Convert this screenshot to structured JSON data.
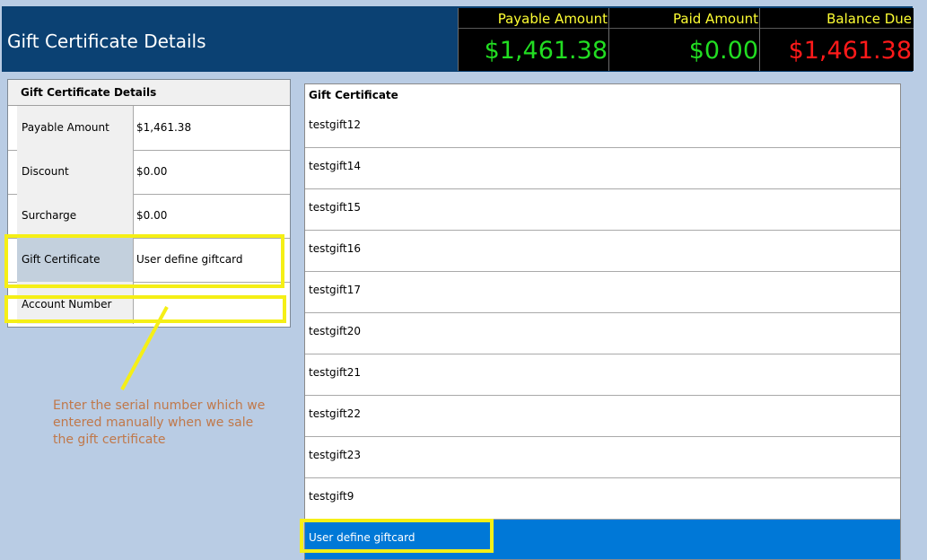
{
  "header": {
    "title": "Gift Certificate Details",
    "payable": {
      "label": "Payable Amount",
      "value": "$1,461.38",
      "color": "#22dd22"
    },
    "paid": {
      "label": "Paid Amount",
      "value": "$0.00",
      "color": "#22dd22"
    },
    "balance": {
      "label": "Balance Due",
      "value": "$1,461.38",
      "color": "#ff1a1a"
    }
  },
  "details": {
    "title": "Gift Certificate Details",
    "rows": [
      {
        "label": "Payable Amount",
        "value": "$1,461.38"
      },
      {
        "label": "Discount",
        "value": "$0.00"
      },
      {
        "label": "Surcharge",
        "value": "$0.00"
      },
      {
        "label": "Gift Certificate",
        "value": "User define giftcard"
      },
      {
        "label": "Account Number",
        "value": ""
      }
    ]
  },
  "list": {
    "header": "Gift Certificate",
    "items": [
      "testgift12",
      "testgift14",
      "testgift15",
      "testgift16",
      "testgift17",
      "testgift20",
      "testgift21",
      "testgift22",
      "testgift23",
      "testgift9",
      "User define giftcard"
    ],
    "selected_index": 10
  },
  "annotation": {
    "text": "Enter the serial number which we entered manually when we sale the gift certificate",
    "color": "#c0784a",
    "highlight_color": "#f5ef16"
  }
}
